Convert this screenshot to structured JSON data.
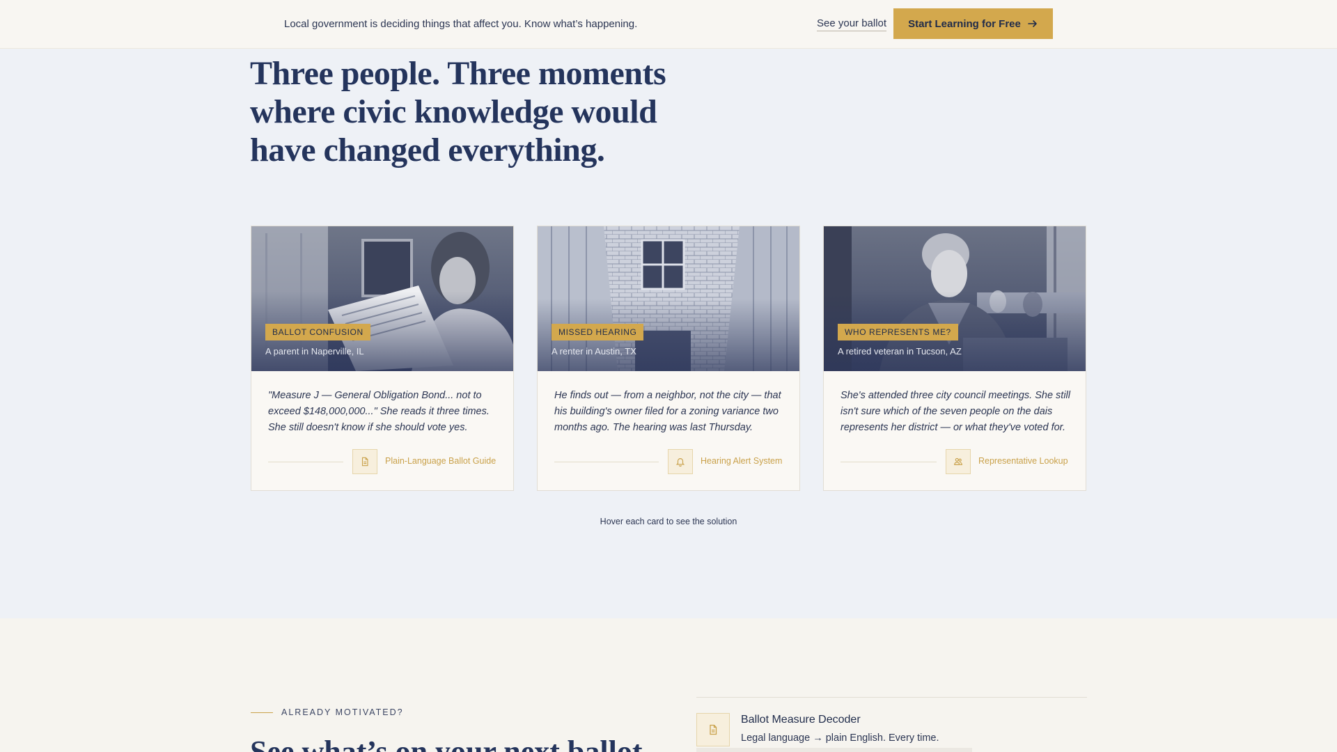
{
  "topbar": {
    "message": "Local government is deciding things that affect you. Know what’s happening.",
    "ballot_link": "See your ballot",
    "cta_label": "Start Learning for Free",
    "cta_icon": "arrow-right-icon"
  },
  "headline": "Three people. Three moments where civic knowledge would have changed everything.",
  "cards": [
    {
      "tag": "BALLOT CONFUSION",
      "subtitle": "A parent in Naperville, IL",
      "quote": "\"Measure J — General Obligation Bond... not to exceed $148,000,000...\" She reads it three times. She still doesn't know if she should vote yes.",
      "solution_label": "Plain-Language Ballot Guide",
      "solution_icon": "document-icon"
    },
    {
      "tag": "MISSED HEARING",
      "subtitle": "A renter in Austin, TX",
      "quote": "He finds out — from a neighbor, not the city — that his building's owner filed for a zoning variance two months ago. The hearing was last Thursday.",
      "solution_label": "Hearing Alert System",
      "solution_icon": "bell-icon"
    },
    {
      "tag": "WHO REPRESENTS ME?",
      "subtitle": "A retired veteran in Tucson, AZ",
      "quote": "She's attended three city council meetings. She still isn't sure which of the seven people on the dais represents her district — or what they've voted for.",
      "solution_label": "Representative Lookup",
      "solution_icon": "people-icon"
    }
  ],
  "hover_hint": "Hover each card to see the solution",
  "lower": {
    "eyebrow": "ALREADY MOTIVATED?",
    "heading": "See what’s on your next ballot",
    "feature": {
      "title": "Ballot Measure Decoder",
      "description": "Legal language → plain English. Every time.",
      "icon": "document-icon"
    }
  },
  "colors": {
    "accent": "#d3a84d",
    "navy": "#24345c",
    "page_bg": "#eef1f6",
    "bar_bg": "#f8f6f2"
  }
}
